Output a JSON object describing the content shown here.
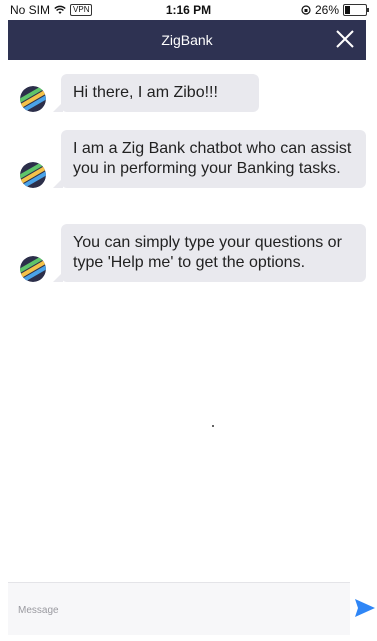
{
  "status_bar": {
    "carrier": "No SIM",
    "vpn": "VPN",
    "time": "1:16 PM",
    "battery": "26%",
    "battery_level": 0.26
  },
  "header": {
    "title": "ZigBank",
    "close_icon": "close-icon",
    "background_color": "#2e3252"
  },
  "messages": [
    {
      "sender": "bot",
      "text": "Hi there, I am Zibo!!!"
    },
    {
      "sender": "bot",
      "text": "I am a Zig Bank chatbot who can assist you in performing your Banking tasks."
    },
    {
      "sender": "bot",
      "text": "You can simply type your questions or type 'Help me' to get the options."
    }
  ],
  "composer": {
    "placeholder": "Message",
    "value": "",
    "send_icon": "send-icon",
    "send_color": "#2f86f6"
  }
}
